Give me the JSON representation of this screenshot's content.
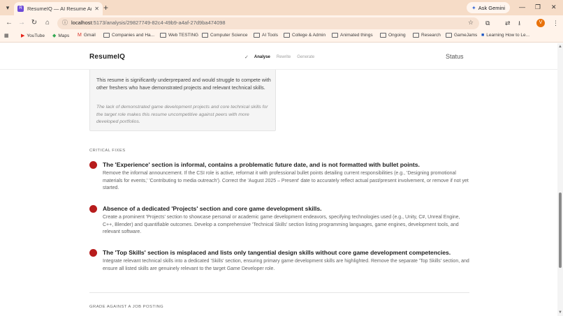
{
  "browser": {
    "tab_title": "ResumeIQ — AI Resume Analyser",
    "tab_favicon": "R",
    "url_host": "localhost",
    "url_rest": ":5173/analysis/29827749-82c4-49b9-a4af-27d9ba474098",
    "ask_gemini": "Ask Gemini",
    "profile_initial": "V",
    "bookmarks": [
      {
        "label": "YouTube",
        "icon": "youtube-icon"
      },
      {
        "label": "Maps",
        "icon": "maps-icon"
      },
      {
        "label": "Gmail",
        "icon": "gmail-icon"
      },
      {
        "label": "Companies and Ha...",
        "icon": "folder-icon"
      },
      {
        "label": "Web TESTING",
        "icon": "folder-icon"
      },
      {
        "label": "Computer Science",
        "icon": "folder-icon"
      },
      {
        "label": "AI Tools",
        "icon": "folder-icon"
      },
      {
        "label": "College & Admin",
        "icon": "folder-icon"
      },
      {
        "label": "Animated things",
        "icon": "folder-icon"
      },
      {
        "label": "Ongoing",
        "icon": "folder-icon"
      },
      {
        "label": "Research",
        "icon": "folder-icon"
      },
      {
        "label": "GameJams",
        "icon": "folder-icon"
      },
      {
        "label": "Learning How to Le...",
        "icon": "bookmark-icon"
      }
    ]
  },
  "app": {
    "brand": "ResumeIQ",
    "steps": {
      "done_mark": "✓",
      "analyse": "Analyse",
      "rewrite": "Rewrite",
      "generate": "Generate"
    },
    "status": "Status"
  },
  "verdict": {
    "text": "This resume is significantly underprepared and would struggle to compete with other freshers who have demonstrated projects and relevant technical skills.",
    "note": "The lack of demonstrated game development projects and core technical skills for the target role makes this resume uncompetitive against peers with more developed portfolios."
  },
  "critical_fixes": {
    "label": "CRITICAL FIXES",
    "items": [
      {
        "title": "The 'Experience' section is informal, contains a problematic future date, and is not formatted with bullet points.",
        "body": "Remove the informal announcement. If the CSI role is active, reformat it with professional bullet points detailing current responsibilities (e.g., 'Designing promotional materials for events,' 'Contributing to media outreach'). Correct the 'August 2025 – Present' date to accurately reflect actual past/present involvement, or remove if not yet started."
      },
      {
        "title": "Absence of a dedicated 'Projects' section and core game development skills.",
        "body": "Create a prominent 'Projects' section to showcase personal or academic game development endeavors, specifying technologies used (e.g., Unity, C#, Unreal Engine, C++, Blender) and quantifiable outcomes. Develop a comprehensive 'Technical Skills' section listing programming languages, game engines, development tools, and relevant software."
      },
      {
        "title": "The 'Top Skills' section is misplaced and lists only tangential design skills without core game development competencies.",
        "body": "Integrate relevant technical skills into a dedicated 'Skills' section, ensuring primary game development skills are highlighted. Remove the separate 'Top Skills' section, and ensure all listed skills are genuinely relevant to the target Game Developer role."
      }
    ]
  },
  "grade_section": {
    "label": "GRADE AGAINST A JOB POSTING"
  },
  "colors": {
    "accent_red": "#b71c1c",
    "chrome": "#f6dcc7",
    "favicon": "#6d4bd8"
  }
}
